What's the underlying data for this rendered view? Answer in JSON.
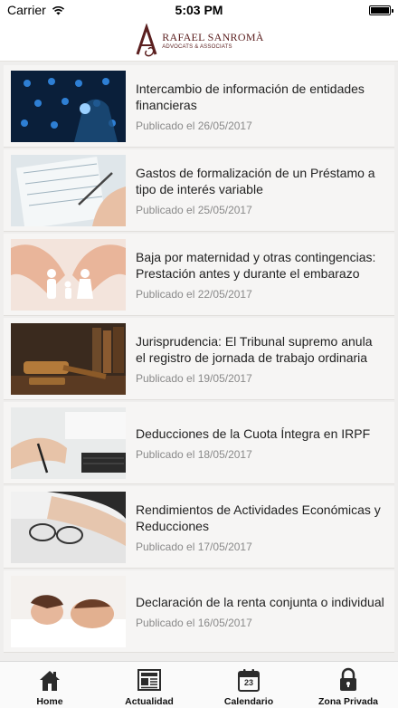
{
  "status_bar": {
    "carrier": "Carrier",
    "time": "5:03 PM"
  },
  "header": {
    "logo_name": "RAFAEL SANROMÀ",
    "logo_sub": "ADVOCATS & ASSOCIATS"
  },
  "articles": [
    {
      "title": "Intercambio de información de entidades financieras",
      "date": "Publicado el 26/05/2017",
      "thumbnail": "network-people-image"
    },
    {
      "title": "Gastos de formalización de un Préstamo a tipo de interés variable",
      "date": "Publicado el 25/05/2017",
      "thumbnail": "signing-document-image"
    },
    {
      "title": "Baja por maternidad y otras contingencias: Prestación antes y durante el embarazo",
      "date": "Publicado el 22/05/2017",
      "thumbnail": "family-hands-image"
    },
    {
      "title": "Jurisprudencia: El Tribunal supremo anula el registro de jornada de trabajo ordinaria",
      "date": "Publicado el 19/05/2017",
      "thumbnail": "gavel-books-image"
    },
    {
      "title": "Deducciones de la Cuota Íntegra en IRPF",
      "date": "Publicado el 18/05/2017",
      "thumbnail": "desk-keyboard-image"
    },
    {
      "title": "Rendimientos de Actividades Económicas y Reducciones",
      "date": "Publicado el 17/05/2017",
      "thumbnail": "glasses-papers-image"
    },
    {
      "title": "Declaración de la renta conjunta o individual",
      "date": "Publicado el 16/05/2017",
      "thumbnail": "couple-bed-image"
    }
  ],
  "tabbar": {
    "home": "Home",
    "actualidad": "Actualidad",
    "calendario": "Calendario",
    "calendar_day": "23",
    "zona_privada": "Zona Privada"
  },
  "colors": {
    "brand": "#5b1f1f",
    "tab_icon": "#2b2b2b",
    "list_bg": "#efeeed",
    "item_bg": "#f6f5f4"
  }
}
